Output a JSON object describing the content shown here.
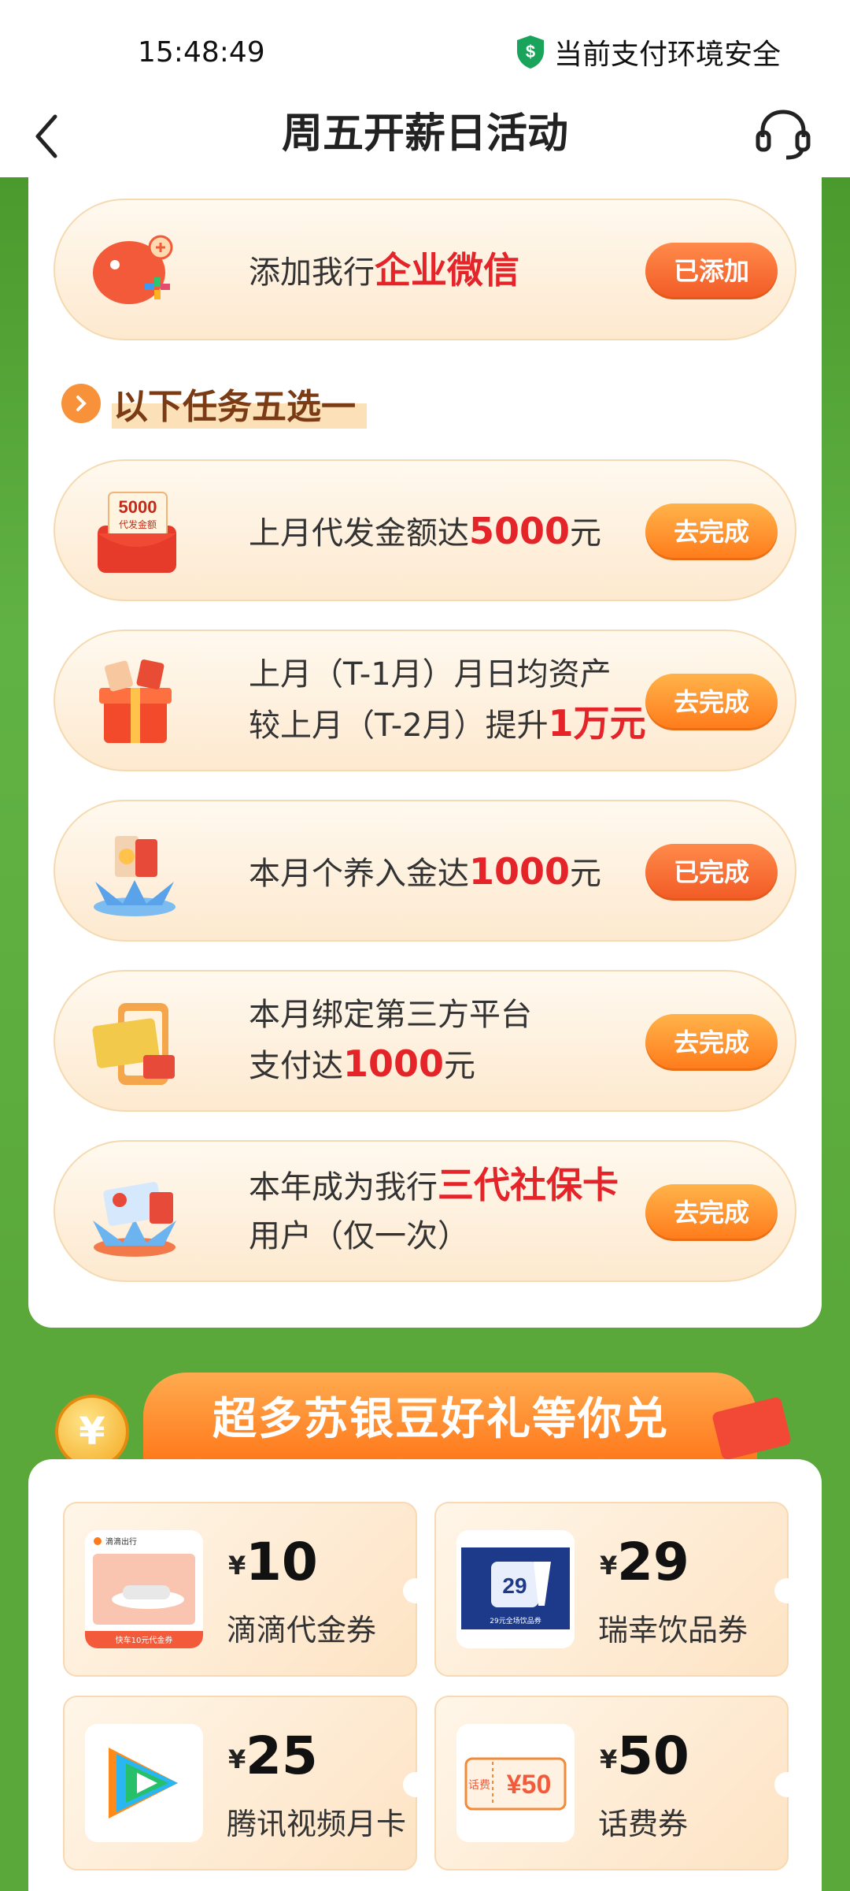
{
  "status_bar": {
    "time": "15:48:49",
    "security_text": "当前支付环境安全"
  },
  "header": {
    "title": "周五开薪日活动"
  },
  "tasks": [
    {
      "line1_prefix": "添加我行",
      "line1_highlight": "企业微信",
      "line1_suffix": "",
      "line2": "",
      "button": "已添加"
    },
    {
      "line1_prefix": "上月代发金额达",
      "line1_highlight": "5000",
      "line1_suffix": "元",
      "line2": "",
      "button": "去完成"
    },
    {
      "line1_prefix": "上月（T-1月）月日均资产",
      "line1_highlight": "",
      "line1_suffix": "",
      "line2_prefix": "较上月（T-2月）提升",
      "line2_highlight": "1万元",
      "button": "去完成"
    },
    {
      "line1_prefix": "本月个养入金达",
      "line1_highlight": "1000",
      "line1_suffix": "元",
      "line2": "",
      "button": "已完成"
    },
    {
      "line1_prefix": "本月绑定第三方平台",
      "line1_highlight": "",
      "line1_suffix": "",
      "line2_prefix": "支付达",
      "line2_highlight": "1000",
      "line2_suffix": "元",
      "button": "去完成"
    },
    {
      "line1_prefix": "本年成为我行",
      "line1_highlight": "三代社保卡",
      "line1_suffix": "",
      "line2_prefix": "用户（仅一次）",
      "button": "去完成"
    }
  ],
  "icons": {
    "task_1": "wechat-work-piggy-icon",
    "task_2": "red-envelope-5000-icon",
    "task_3": "gift-box-icon",
    "task_4": "red-packets-icon",
    "task_5": "bank-card-phone-icon",
    "task_6": "social-security-card-icon"
  },
  "task_images": {
    "t2_top": "5000",
    "t2_sub": "代发金额"
  },
  "subheading": "以下任务五选一",
  "rewards_banner": {
    "title": "超多苏银豆好礼等你兑",
    "coin_symbol": "¥"
  },
  "rewards": [
    {
      "currency": "¥",
      "amount": "10",
      "name": "滴滴代金券",
      "thumb_text": "快车10元代金券",
      "thumb_brand": "滴滴出行"
    },
    {
      "currency": "¥",
      "amount": "29",
      "name": "瑞幸饮品券",
      "thumb_text": "29元全场饮品券",
      "thumb_badge": "29"
    },
    {
      "currency": "¥",
      "amount": "25",
      "name": "腾讯视频月卡"
    },
    {
      "currency": "¥",
      "amount": "50",
      "name": "话费券",
      "thumb_label": "话费",
      "thumb_value": "¥50"
    }
  ],
  "colors": {
    "accent_orange": "#ff7a1a",
    "highlight_red": "#e5242a",
    "background_green": "#5aa83a"
  }
}
